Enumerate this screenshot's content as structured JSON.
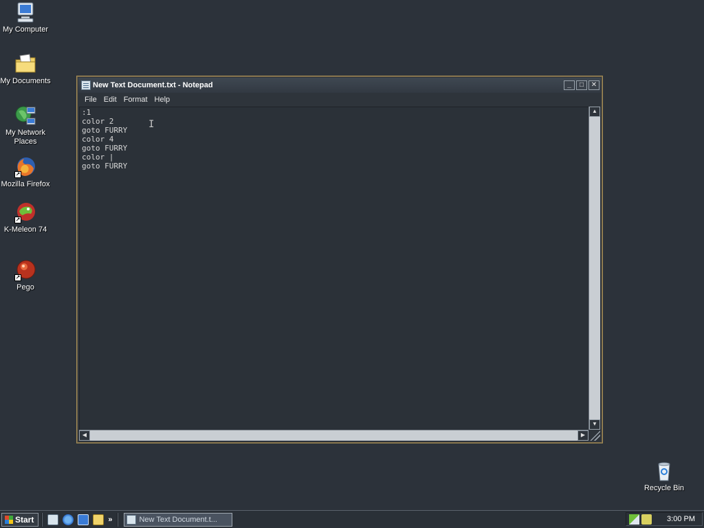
{
  "desktop": {
    "icons": [
      {
        "label": "My Computer",
        "icon": "my-computer-icon"
      },
      {
        "label": "My Documents",
        "icon": "my-documents-icon"
      },
      {
        "label": "My Network Places",
        "icon": "my-network-places-icon"
      },
      {
        "label": "Mozilla Firefox",
        "icon": "firefox-icon"
      },
      {
        "label": "K-Meleon 74",
        "icon": "k-meleon-icon"
      },
      {
        "label": "Pego",
        "icon": "pego-icon"
      },
      {
        "label": "Recycle Bin",
        "icon": "recycle-bin-icon"
      }
    ]
  },
  "window": {
    "title": "New Text Document.txt - Notepad",
    "controls": {
      "minimize": "_",
      "maximize": "□",
      "close": "✕"
    },
    "menu": [
      "File",
      "Edit",
      "Format",
      "Help"
    ],
    "content": ":1\ncolor 2\ngoto FURRY\ncolor 4\ngoto FURRY\ncolor |\ngoto FURRY"
  },
  "taskbar": {
    "start_label": "Start",
    "overflow_label": "»",
    "task_label": "New Text Document.t...",
    "clock": "3:00 PM"
  },
  "colors": {
    "desktop": "#2c323a",
    "window_border": "#a48d55",
    "scrollbar_track": "#c9ced3"
  }
}
